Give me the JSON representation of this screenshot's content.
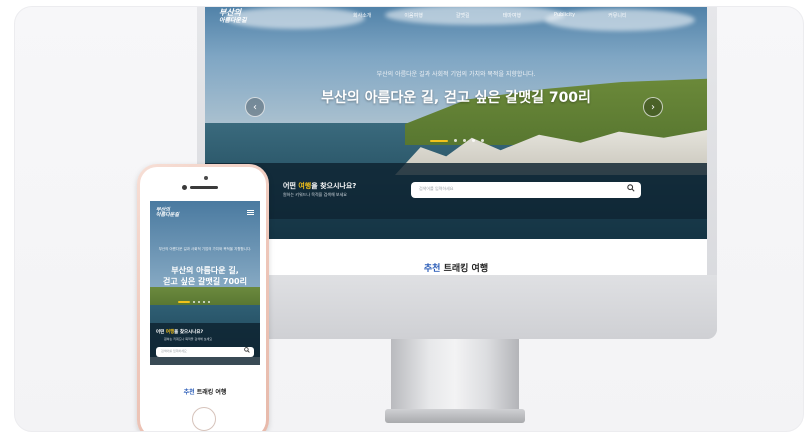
{
  "desktop": {
    "logo": [
      "부산의",
      "아름다운길"
    ],
    "nav": [
      "회사소개",
      "이음여행",
      "갈맷길",
      "테마여행",
      "Publicity",
      "커뮤니티"
    ],
    "hero": {
      "subtitle": "부산의 아름다운 길과 사회적 기업의 가치와 목적을 지향합니다.",
      "title": "부산의 아름다운 길, 걷고 싶은 갈맷길 700리"
    },
    "search": {
      "question_pre": "어떤 ",
      "question_hl": "여행",
      "question_post": "을 찾으시나요?",
      "sub": "원하는 키워드나 목적을 검색해 보세요",
      "placeholder": "검색어를 입력하세요",
      "icon": "search-icon"
    },
    "recommend": {
      "accent": "추천",
      "rest": " 트래킹 여행"
    },
    "arrows": {
      "prev": "‹",
      "next": "›"
    }
  },
  "mobile": {
    "logo": [
      "부산의",
      "아름다운길"
    ],
    "hero": {
      "subtitle": "부산의 아름다운 길과 사회적 기업의 가치와 목적을 지향합니다.",
      "title_line1": "부산의 아름다운 길,",
      "title_line2": "걷고 싶은 갈맷길 700리"
    },
    "search": {
      "question_pre": "어떤 ",
      "question_hl": "여행",
      "question_post": "을 찾으시나요?",
      "sub": "원하는 키워드나 목적을 검색해 보세요",
      "placeholder": "검색어를 입력하세요"
    },
    "recommend": {
      "accent": "추천",
      "rest": " 트래킹 여행"
    }
  },
  "colors": {
    "accent_yellow": "#f2c21a",
    "accent_blue": "#2b5db8"
  }
}
